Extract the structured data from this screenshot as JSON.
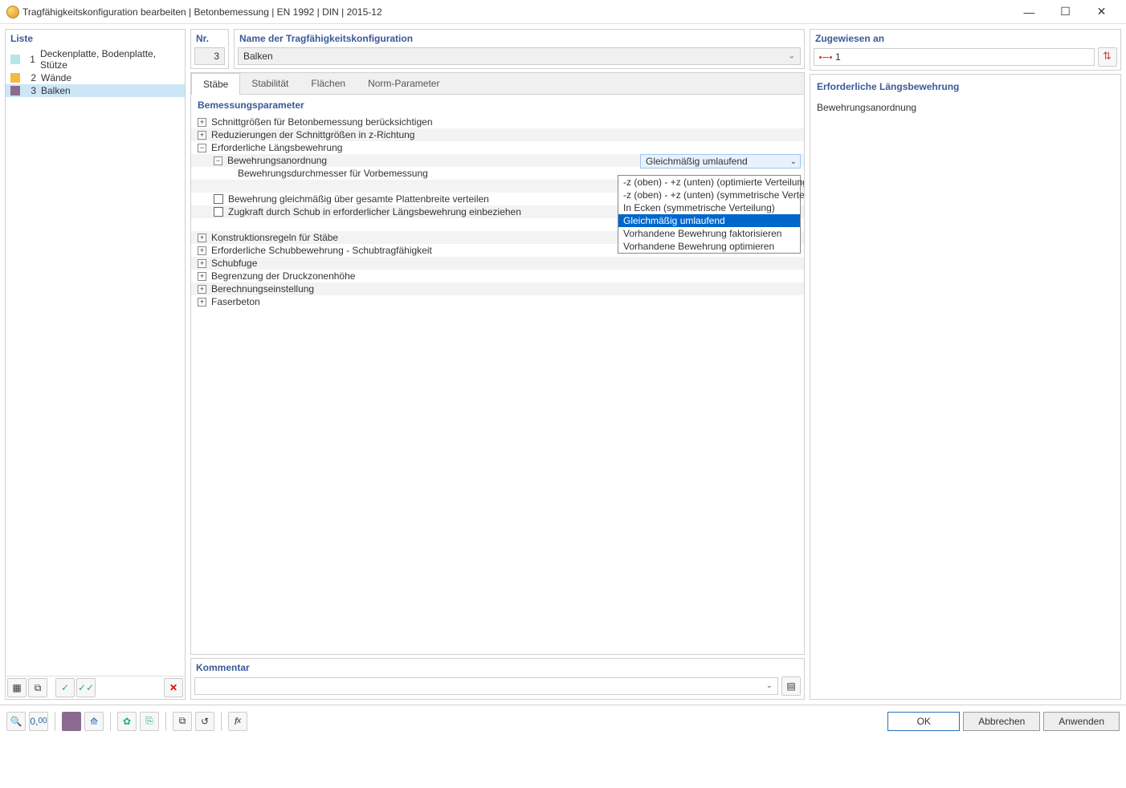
{
  "window": {
    "title": "Tragfähigkeitskonfiguration bearbeiten | Betonbemessung | EN 1992 | DIN | 2015-12"
  },
  "left": {
    "header": "Liste",
    "items": [
      {
        "num": "1",
        "label": "Deckenplatte, Bodenplatte, Stütze",
        "color": "#b5e7e7",
        "selected": false
      },
      {
        "num": "2",
        "label": "Wände",
        "color": "#f5b942",
        "selected": false
      },
      {
        "num": "3",
        "label": "Balken",
        "color": "#8a6b8f",
        "selected": true
      }
    ]
  },
  "nr": {
    "label": "Nr.",
    "value": "3"
  },
  "name": {
    "label": "Name der Tragfähigkeitskonfiguration",
    "value": "Balken"
  },
  "tabs": {
    "items": [
      "Stäbe",
      "Stabilität",
      "Flächen",
      "Norm-Parameter"
    ],
    "active": 0
  },
  "tree": {
    "header": "Bemessungsparameter",
    "rows": [
      {
        "lvl": 0,
        "type": "exp",
        "state": "+",
        "label": "Schnittgrößen für Betonbemessung berücksichtigen",
        "alt": false
      },
      {
        "lvl": 0,
        "type": "exp",
        "state": "+",
        "label": "Reduzierungen der Schnittgrößen in z-Richtung",
        "alt": true
      },
      {
        "lvl": 0,
        "type": "exp",
        "state": "−",
        "label": "Erforderliche Längsbewehrung",
        "alt": false
      },
      {
        "lvl": 1,
        "type": "exp",
        "state": "−",
        "label": "Bewehrungsanordnung",
        "alt": true,
        "combo": true
      },
      {
        "lvl": 2,
        "type": "txt",
        "label": "Bewehrungsdurchmesser für Vorbemessung",
        "alt": false
      },
      {
        "lvl": 2,
        "type": "gap",
        "alt": true
      },
      {
        "lvl": 1,
        "type": "chk",
        "label": "Bewehrung gleichmäßig über gesamte Plattenbreite verteilen",
        "alt": false
      },
      {
        "lvl": 1,
        "type": "chk",
        "label": "Zugkraft durch Schub in erforderlicher Längsbewehrung einbeziehen",
        "alt": true
      },
      {
        "lvl": 2,
        "type": "gap",
        "alt": false
      },
      {
        "lvl": 0,
        "type": "exp",
        "state": "+",
        "label": "Konstruktionsregeln für Stäbe",
        "alt": true
      },
      {
        "lvl": 0,
        "type": "exp",
        "state": "+",
        "label": "Erforderliche Schubbewehrung - Schubtragfähigkeit",
        "alt": false
      },
      {
        "lvl": 0,
        "type": "exp",
        "state": "+",
        "label": "Schubfuge",
        "alt": true
      },
      {
        "lvl": 0,
        "type": "exp",
        "state": "+",
        "label": "Begrenzung der Druckzonenhöhe",
        "alt": false
      },
      {
        "lvl": 0,
        "type": "exp",
        "state": "+",
        "label": "Berechnungseinstellung",
        "alt": true
      },
      {
        "lvl": 0,
        "type": "exp",
        "state": "+",
        "label": "Faserbeton",
        "alt": false
      }
    ],
    "combo_value": "Gleichmäßig umlaufend",
    "dropdown": [
      "-z (oben) - +z (unten) (optimierte Verteilung)",
      "-z (oben) - +z (unten) (symmetrische Verteilung)",
      "In Ecken (symmetrische Verteilung)",
      "Gleichmäßig umlaufend",
      "Vorhandene Bewehrung faktorisieren",
      "Vorhandene Bewehrung optimieren"
    ],
    "dropdown_highlight": 3
  },
  "kommentar": {
    "label": "Kommentar",
    "value": ""
  },
  "assigned": {
    "label": "Zugewiesen an",
    "value": "1"
  },
  "detail": {
    "title": "Erforderliche Längsbewehrung",
    "subtitle": "Bewehrungsanordnung"
  },
  "footer": {
    "ok": "OK",
    "cancel": "Abbrechen",
    "apply": "Anwenden"
  }
}
